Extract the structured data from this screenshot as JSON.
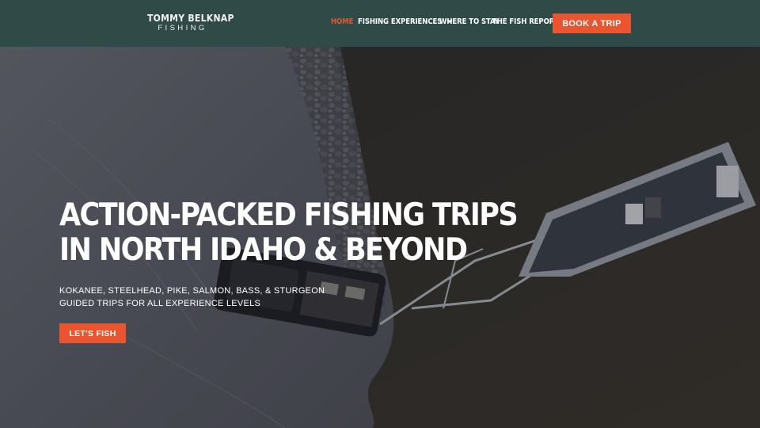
{
  "brand": {
    "name_top": "TOMMY BELKNAP",
    "name_bottom": "FISHING"
  },
  "nav": {
    "items": [
      {
        "label": "HOME",
        "active": true
      },
      {
        "label": "FISHING EXPERIENCES",
        "has_dropdown": true
      },
      {
        "label": "WHERE TO STAY"
      },
      {
        "label": "THE FISH REPORT"
      }
    ],
    "cta_label": "BOOK A TRIP"
  },
  "hero": {
    "headline": "ACTION-PACKED FISHING TRIPS IN NORTH IDAHO & BEYOND",
    "subheadline": "KOKANEE, STEELHEAD, PIKE, SALMON, BASS, & STURGEON GUIDED TRIPS FOR ALL EXPERIENCE LEVELS",
    "button_label": "LET'S FISH",
    "background": "aerial-photo-of-truck-towing-boat-at-lake-shore"
  },
  "colors": {
    "header_bg": "#2f4a47",
    "accent": "#e8552e",
    "text": "#ffffff"
  }
}
